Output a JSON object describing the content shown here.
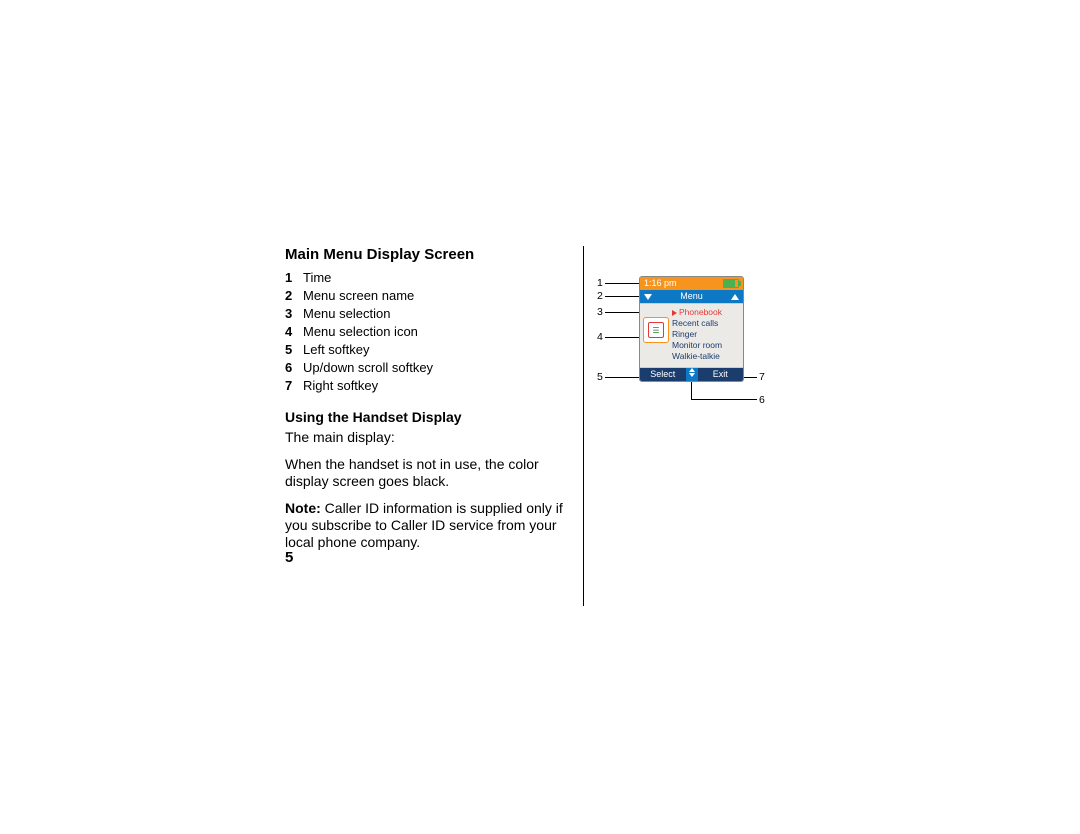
{
  "section_title": "Main Menu Display Screen",
  "legend": [
    {
      "n": "1",
      "t": "Time"
    },
    {
      "n": "2",
      "t": "Menu screen name"
    },
    {
      "n": "3",
      "t": "Menu selection"
    },
    {
      "n": "4",
      "t": "Menu selection icon"
    },
    {
      "n": "5",
      "t": "Left softkey"
    },
    {
      "n": "6",
      "t": "Up/down scroll softkey"
    },
    {
      "n": "7",
      "t": "Right softkey"
    }
  ],
  "sub_title": "Using the Handset Display",
  "body1": "The main display:",
  "body2": "When the handset is not in use, the color display screen goes black.",
  "note_label": "Note:",
  "note_body": " Caller ID information is supplied only if you subscribe to Caller ID service from your local phone company.",
  "page_number": "5",
  "screen": {
    "time": "1:16 pm",
    "menu_label": "Menu",
    "items": [
      "Phonebook",
      "Recent calls",
      "Ringer",
      "Monitor room",
      "Walkie-talkie"
    ],
    "left_softkey": "Select",
    "right_softkey": "Exit"
  },
  "callouts": {
    "c1": "1",
    "c2": "2",
    "c3": "3",
    "c4": "4",
    "c5": "5",
    "c6": "6",
    "c7": "7"
  }
}
